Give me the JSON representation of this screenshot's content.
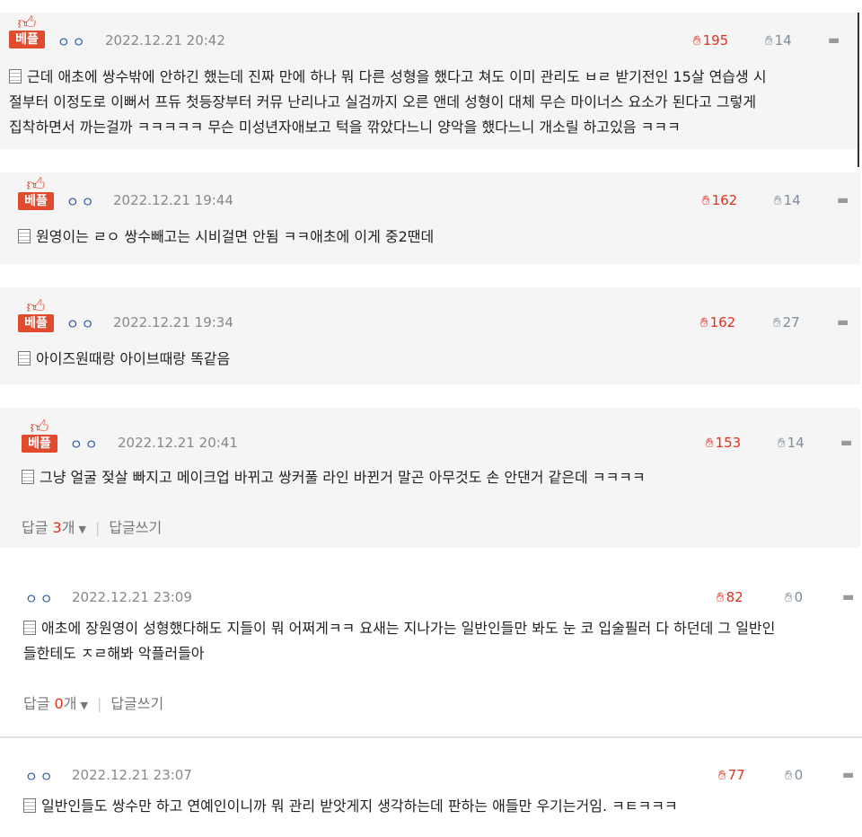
{
  "best_label": "베플",
  "comments": [
    {
      "best": true,
      "nick": "ㅇㅇ",
      "date": "2022.12.21 20:42",
      "likes": "195",
      "dislikes": "14",
      "text_lines": [
        "근데 애초에 쌍수밖에 안하긴 했는데 진짜 만에 하나 뭐 다른 성형을 했다고 쳐도 이미 관리도 ㅂㄹ 받기전인 15살 연습생 시",
        "절부터 이정도로 이뻐서 프듀 첫등장부터 커뮤 난리나고 실검까지 오른 앤데 성형이 대체 무슨 마이너스 요소가 된다고 그렇게",
        "집착하면서 까는걸까 ㅋㅋㅋㅋㅋ 무슨 미성년자애보고 턱을 깎았다느니 양악을 했다느니 개소릴 하고있음 ㅋㅋㅋ"
      ]
    },
    {
      "best": true,
      "nick": "ㅇㅇ",
      "date": "2022.12.21 19:44",
      "likes": "162",
      "dislikes": "14",
      "text_lines": [
        "원영이는 ㄹㅇ 쌍수빼고는 시비걸면 안됨 ㅋㅋ애초에 이게 중2땐데"
      ]
    },
    {
      "best": true,
      "nick": "ㅇㅇ",
      "date": "2022.12.21 19:34",
      "likes": "162",
      "dislikes": "27",
      "text_lines": [
        "아이즈원때랑 아이브때랑 똑같음"
      ]
    },
    {
      "best": true,
      "nick": "ㅇㅇ",
      "date": "2022.12.21 20:41",
      "likes": "153",
      "dislikes": "14",
      "text_lines": [
        "그냥 얼굴 젖살 빠지고 메이크업 바뀌고 쌍커풀 라인 바뀐거 말곤 아무것도 손 안댄거 같은데 ㅋㅋㅋㅋ"
      ],
      "reply_label": "답글",
      "reply_count": "3",
      "reply_unit": "개",
      "write_reply": "답글쓰기"
    },
    {
      "best": false,
      "nick": "ㅇㅇ",
      "date": "2022.12.21 23:09",
      "likes": "82",
      "dislikes": "0",
      "text_lines": [
        "애초에 장원영이 성형했다해도 지들이 뭐 어쩌게ㅋㅋ 요새는 지나가는 일반인들만 봐도 눈 코 입술필러 다 하던데 그 일반인",
        "들한테도 ㅈㄹ해봐 악플러들아"
      ],
      "reply_label": "답글",
      "reply_count": "0",
      "reply_unit": "개",
      "write_reply": "답글쓰기"
    },
    {
      "best": false,
      "nick": "ㅇㅇ",
      "date": "2022.12.21 23:07",
      "likes": "77",
      "dislikes": "0",
      "text_lines": [
        "일반인들도 쌍수만 하고 연예인이니까 뭐 관리 받앗게지 생각하는데 판하는 애들만 우기는거임. ㅋㅌㅋㅋㅋ"
      ]
    }
  ]
}
